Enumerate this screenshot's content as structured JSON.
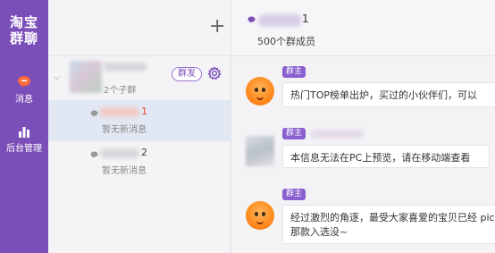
{
  "app": {
    "logo_line1": "淘宝",
    "logo_line2": "群聊"
  },
  "nav": [
    {
      "label": "消息",
      "icon": "message-bubble-icon"
    },
    {
      "label": "后台管理",
      "icon": "bar-chart-icon"
    }
  ],
  "group": {
    "member_count": "2个子群",
    "mass_send_label": "群发"
  },
  "subgroups": [
    {
      "name_suffix": "1",
      "status": "暂无新消息"
    },
    {
      "name_suffix": "2",
      "status": "暂无新消息"
    }
  ],
  "chat": {
    "name_suffix": "1",
    "members": "500个群成员",
    "messages": [
      {
        "role": "群主",
        "text": "热门TOP榜单出炉，买过的小伙伴们，可以"
      },
      {
        "role": "群主",
        "text": "本信息无法在PC上预览，请在移动端查看"
      },
      {
        "role": "群主",
        "text": "经过激烈的角逐，最受大家喜爱的宝贝已经 pick那款入选没~"
      }
    ]
  },
  "colors": {
    "rail": "#7b4fb8",
    "accent": "#8a5fcf",
    "unread": "#e8452c"
  }
}
